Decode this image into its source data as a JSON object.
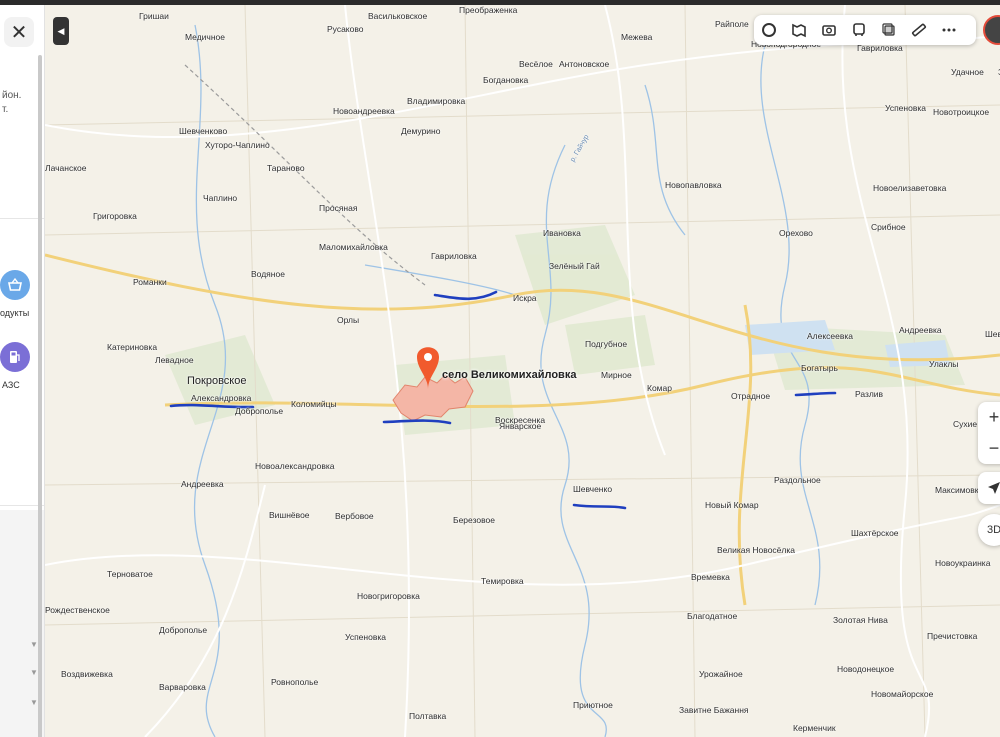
{
  "sidebar": {
    "close_icon": "close-icon",
    "close_glyph": "✕",
    "text_fragment": "йон.\nт.",
    "buttons": [
      {
        "name": "products",
        "label": "одукты",
        "icon": "basket-icon",
        "color": "#6aa8e8"
      },
      {
        "name": "gas",
        "label": "АЗС",
        "icon": "fuel-icon",
        "color": "#7b6fd6"
      }
    ]
  },
  "toolbar": {
    "icons": [
      "layers-icon",
      "panorama-icon",
      "photo-icon",
      "transit-icon",
      "overlay-icon",
      "ruler-icon",
      "more-icon"
    ]
  },
  "controls": {
    "zoom_in": "+",
    "zoom_out": "−",
    "three_d": "3D",
    "locate_icon": "navigation-arrow-icon"
  },
  "map": {
    "selected_place": "село Великомихайловка",
    "accent_color": "#f15a2d",
    "highlight_color": "#f4b6a6",
    "drawn_line_color": "#1f3fbf",
    "places": [
      {
        "name": "Гришаи"
      },
      {
        "name": "Медичное"
      },
      {
        "name": "Русаково"
      },
      {
        "name": "Васильковское"
      },
      {
        "name": "Преображенка"
      },
      {
        "name": "Межева"
      },
      {
        "name": "Райполе"
      },
      {
        "name": "Новоподгородное"
      },
      {
        "name": "Гавриловка"
      },
      {
        "name": "Удачное"
      },
      {
        "name": "Зверево"
      },
      {
        "name": "Весёлое"
      },
      {
        "name": "Антоновское"
      },
      {
        "name": "Богдановка"
      },
      {
        "name": "Новоандреевка"
      },
      {
        "name": "Владимировка"
      },
      {
        "name": "Успеновка"
      },
      {
        "name": "Новотроицкое"
      },
      {
        "name": "Шевченково"
      },
      {
        "name": "Хуторо-Чаплино"
      },
      {
        "name": "Демурино"
      },
      {
        "name": "Лачанское"
      },
      {
        "name": "Тараново"
      },
      {
        "name": "Новопавловка"
      },
      {
        "name": "Новоелизаветовка"
      },
      {
        "name": "Чаплино"
      },
      {
        "name": "Просяная"
      },
      {
        "name": "Григоровка"
      },
      {
        "name": "Орехово"
      },
      {
        "name": "Срибное"
      },
      {
        "name": "Ивановка"
      },
      {
        "name": "Маломихайловка"
      },
      {
        "name": "Гавриловка"
      },
      {
        "name": "Зелёный Гай"
      },
      {
        "name": "Водяное"
      },
      {
        "name": "Романки"
      },
      {
        "name": "Искра"
      },
      {
        "name": "Орлы"
      },
      {
        "name": "Алексеевка"
      },
      {
        "name": "Андреевка"
      },
      {
        "name": "Шевч"
      },
      {
        "name": "Катериновка"
      },
      {
        "name": "Подгубное"
      },
      {
        "name": "Левадное"
      },
      {
        "name": "Богатырь"
      },
      {
        "name": "Улаклы"
      },
      {
        "name": "Покровское"
      },
      {
        "name": "Мирное"
      },
      {
        "name": "Комар"
      },
      {
        "name": "Александровка"
      },
      {
        "name": "Отрадное"
      },
      {
        "name": "Разлив"
      },
      {
        "name": "Доброполье"
      },
      {
        "name": "Коломийцы"
      },
      {
        "name": "Воскресенка"
      },
      {
        "name": "Январское"
      },
      {
        "name": "Сухие"
      },
      {
        "name": "Новоалександровка"
      },
      {
        "name": "Раздольное"
      },
      {
        "name": "Андреевка"
      },
      {
        "name": "Максимовка"
      },
      {
        "name": "Шевченко"
      },
      {
        "name": "Вишнёвое"
      },
      {
        "name": "Вербовое"
      },
      {
        "name": "Березовое"
      },
      {
        "name": "Новый Комар"
      },
      {
        "name": "Шахтёрское"
      },
      {
        "name": "Великая Новосёлка"
      },
      {
        "name": "Новоукраинка"
      },
      {
        "name": "Терноватое"
      },
      {
        "name": "Темировка"
      },
      {
        "name": "Времевка"
      },
      {
        "name": "Рождественское"
      },
      {
        "name": "Новогригоровка"
      },
      {
        "name": "Доброполье"
      },
      {
        "name": "Успеновка"
      },
      {
        "name": "Благодатное"
      },
      {
        "name": "Золотая Нива"
      },
      {
        "name": "Пречистовка"
      },
      {
        "name": "Воздвижевка"
      },
      {
        "name": "Ровнополье"
      },
      {
        "name": "Урожайное"
      },
      {
        "name": "Новодонецкое"
      },
      {
        "name": "Варваровка"
      },
      {
        "name": "Новомайорское"
      },
      {
        "name": "Приютное"
      },
      {
        "name": "Завитне Бажання"
      },
      {
        "name": "Полтавка"
      },
      {
        "name": "Керменчик"
      },
      {
        "name": "Ольховка"
      },
      {
        "name": "р. Гайчур"
      }
    ]
  }
}
